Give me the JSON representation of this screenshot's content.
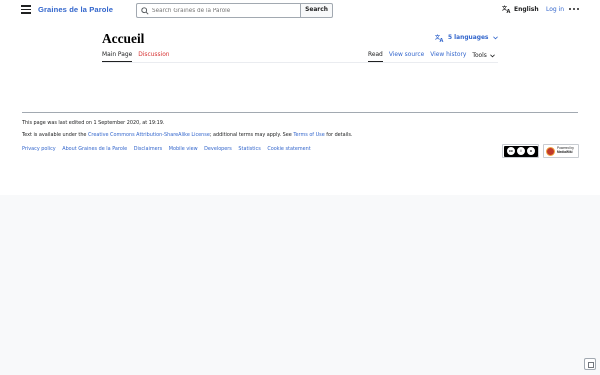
{
  "header": {
    "site_name": "Graines de la Parole",
    "search_placeholder": "Search Graines de la Parole",
    "search_button": "Search",
    "language": "English",
    "login": "Log in"
  },
  "page": {
    "title": "Accueil",
    "languages_button": "5 languages",
    "tabs_left": [
      "Main Page",
      "Discussion"
    ],
    "tabs_right": [
      "Read",
      "View source",
      "View history",
      "Tools"
    ]
  },
  "footer": {
    "last_edited": "This page was last edited on 1 September 2020, at 19:19.",
    "license_prefix": "Text is available under the ",
    "license_link": "Creative Commons Attribution-ShareAlike License",
    "license_middle": "; additional terms may apply. See ",
    "terms_link": "Terms of Use",
    "license_suffix": " for details.",
    "links": [
      "Privacy policy",
      "About Graines de la Parole",
      "Disclaimers",
      "Mobile view",
      "Developers",
      "Statistics",
      "Cookie statement"
    ],
    "mediawiki_badge": [
      "Powered by",
      "MediaWiki"
    ]
  },
  "colors": {
    "link": "#3366cc",
    "new_link": "#d73333",
    "text": "#202122"
  }
}
